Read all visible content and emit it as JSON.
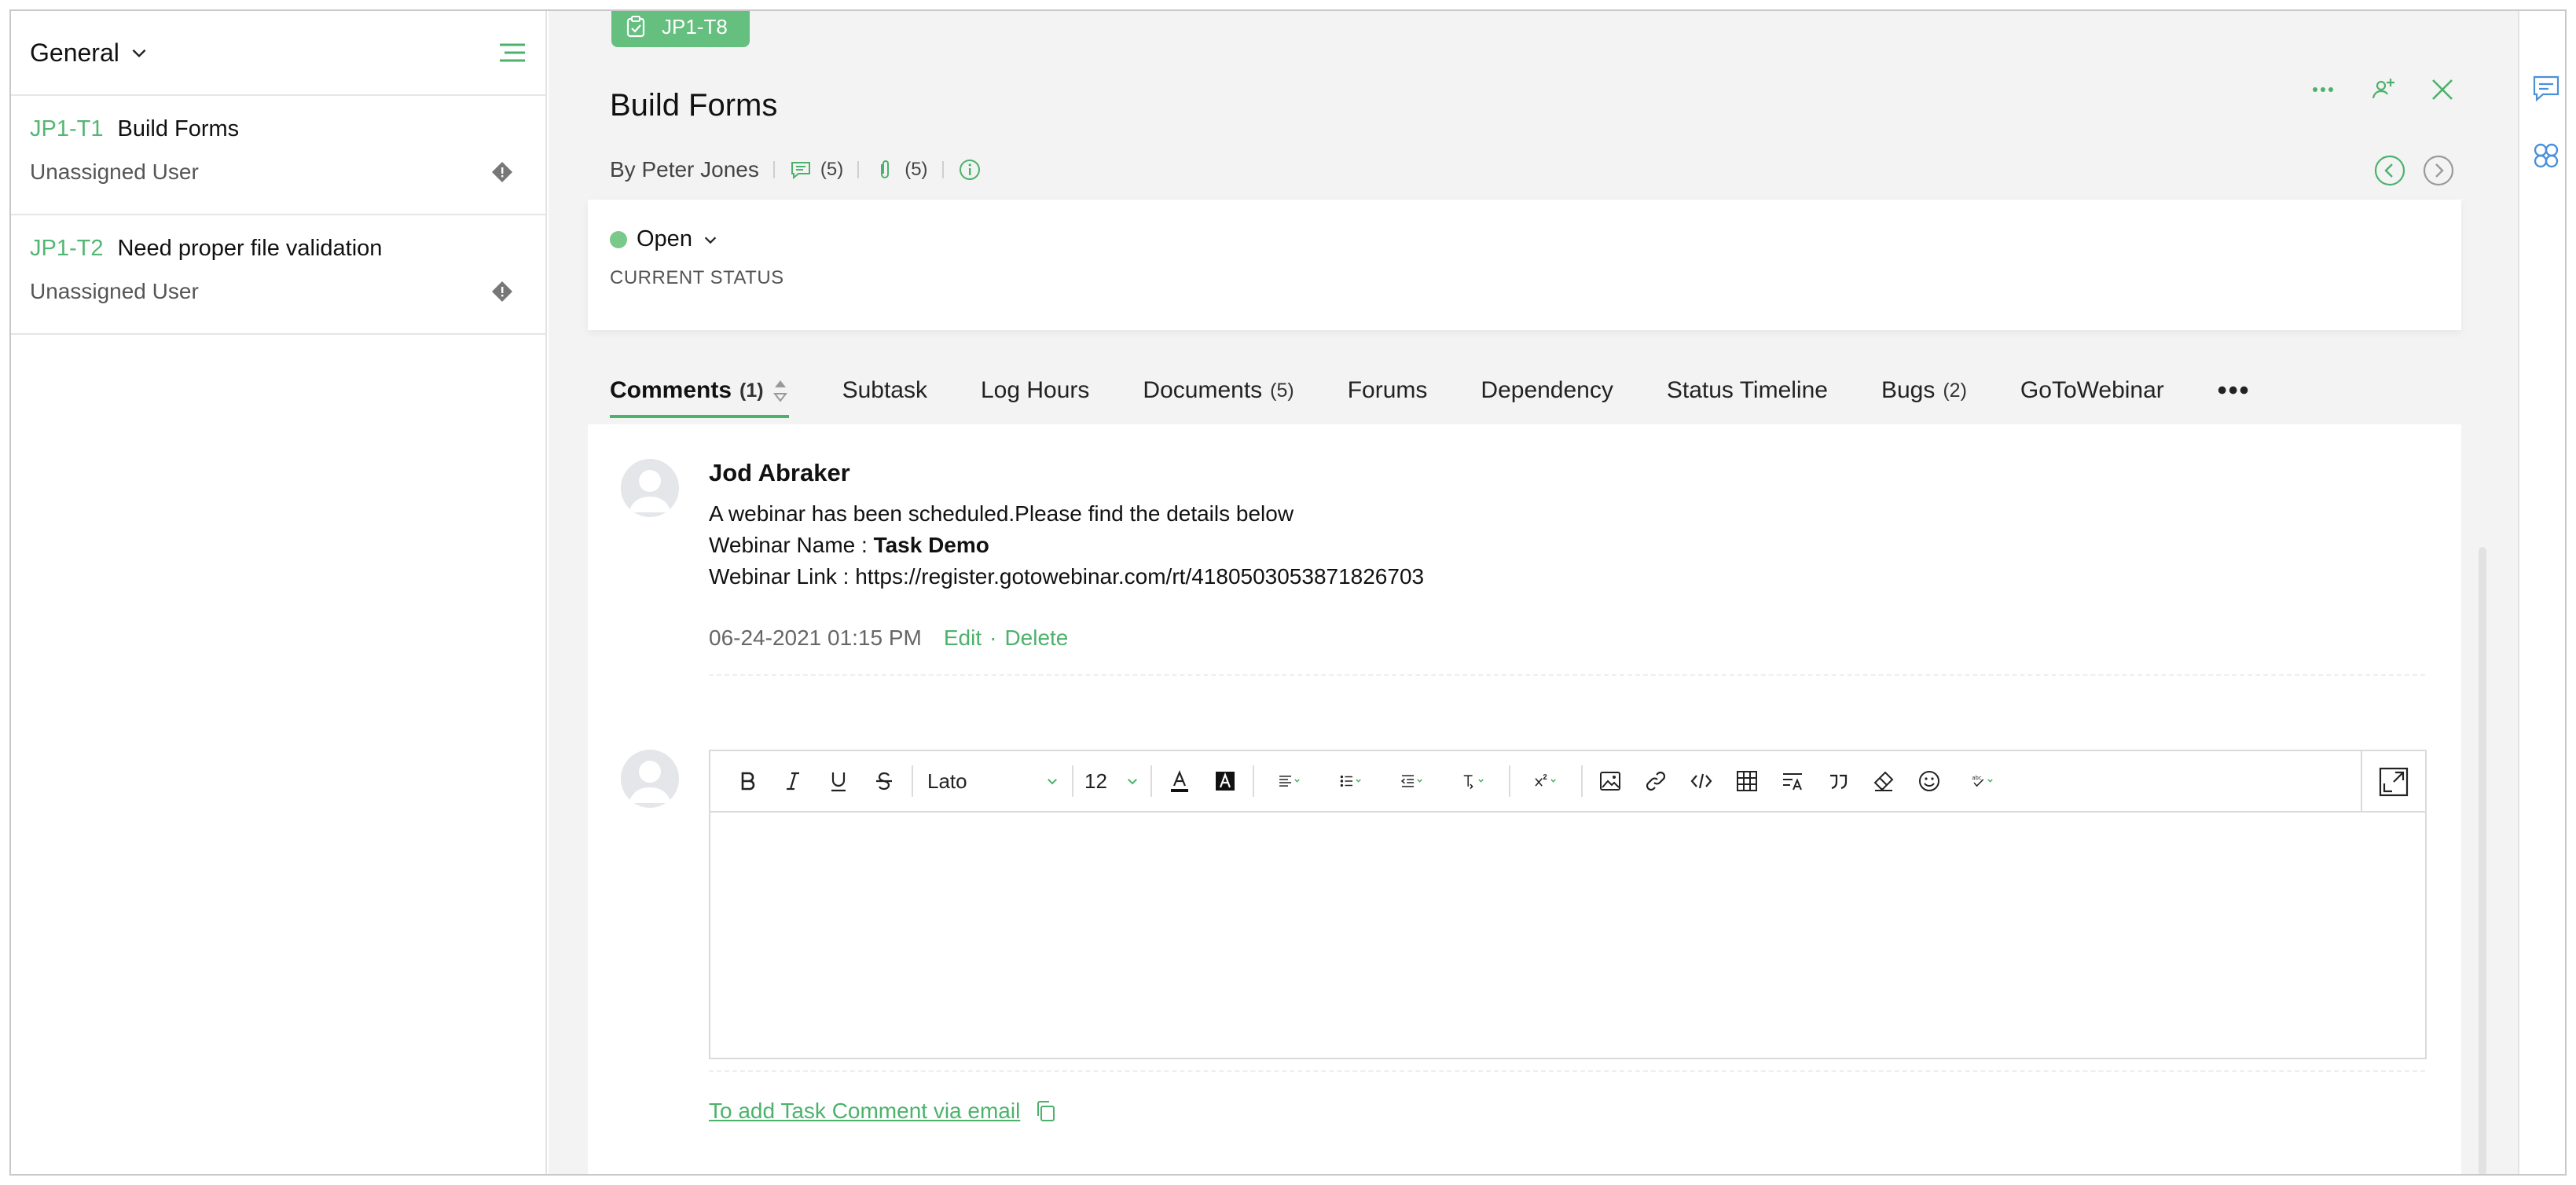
{
  "sidebar": {
    "title": "General",
    "tasks": [
      {
        "id": "JP1-T1",
        "name": "Build Forms",
        "assignee": "Unassigned User"
      },
      {
        "id": "JP1-T2",
        "name": "Need proper file validation",
        "assignee": "Unassigned User"
      }
    ]
  },
  "task": {
    "tag": "JP1-T8",
    "title": "Build Forms",
    "by": "By Peter Jones",
    "comment_count": "(5)",
    "attachment_count": "(5)"
  },
  "status": {
    "value": "Open",
    "label": "CURRENT STATUS",
    "color": "#79c98a"
  },
  "tabs": [
    {
      "label": "Comments",
      "count": "(1)"
    },
    {
      "label": "Subtask",
      "count": ""
    },
    {
      "label": "Log Hours",
      "count": ""
    },
    {
      "label": "Documents",
      "count": "(5)"
    },
    {
      "label": "Forums",
      "count": ""
    },
    {
      "label": "Dependency",
      "count": ""
    },
    {
      "label": "Status Timeline",
      "count": ""
    },
    {
      "label": "Bugs",
      "count": "(2)"
    },
    {
      "label": "GoToWebinar",
      "count": ""
    }
  ],
  "comment": {
    "author": "Jod Abraker",
    "line1": "A webinar has been scheduled.Please find the details below",
    "line2_prefix": "Webinar Name : ",
    "line2_value": "Task Demo",
    "line3": "Webinar Link : https://register.gotowebinar.com/rt/4180503053871826703",
    "timestamp": "06-24-2021 01:15 PM",
    "edit": "Edit",
    "dot": "·",
    "delete": "Delete"
  },
  "editor": {
    "font": "Lato",
    "size": "12"
  },
  "email_link": "To add Task Comment via email",
  "accent_color": "#4cb26b"
}
